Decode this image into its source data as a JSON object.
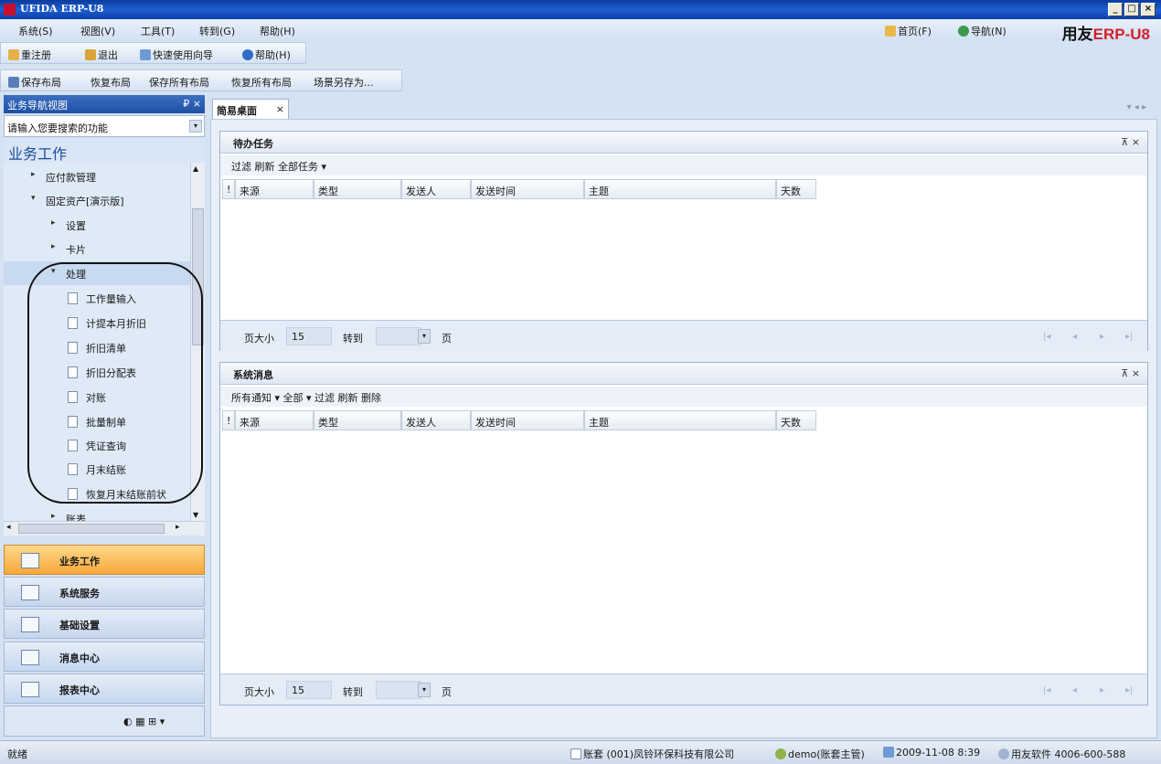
{
  "window": {
    "title": "UFIDA ERP-U8",
    "controls": [
      "_",
      "□",
      "×"
    ]
  },
  "menu": {
    "items": [
      "系统(S)",
      "视图(V)",
      "工具(T)",
      "转到(G)",
      "帮助(H)"
    ],
    "right": {
      "home": "首页(F)",
      "nav": "导航(N)"
    },
    "brand_a": "用友",
    "brand_b": "ERP",
    "brand_c": "-U8"
  },
  "toolbar1": {
    "relogin": "重注册",
    "exit": "退出",
    "guide": "快速使用向导",
    "help": "帮助(H)"
  },
  "toolbar2": {
    "save_layout": "保存布局",
    "restore_layout": "恢复布局",
    "save_all": "保存所有布局",
    "restore_all": "恢复所有布局",
    "scene_save": "场景另存为..."
  },
  "nav": {
    "header": "业务导航视图",
    "pin": "₽ ×",
    "search_placeholder": "请输入您要搜索的功能",
    "section": "业务工作",
    "tree": [
      {
        "label": "应付款管理"
      },
      {
        "label": "固定资产[演示版]"
      },
      {
        "label": "设置"
      },
      {
        "label": "卡片"
      },
      {
        "label": "处理"
      },
      {
        "label": "工作量输入"
      },
      {
        "label": "计提本月折旧"
      },
      {
        "label": "折旧清单"
      },
      {
        "label": "折旧分配表"
      },
      {
        "label": "对账"
      },
      {
        "label": "批量制单"
      },
      {
        "label": "凭证查询"
      },
      {
        "label": "月末结账"
      },
      {
        "label": "恢复月末结账前状"
      },
      {
        "label": "账表"
      }
    ],
    "big_buttons": [
      "业务工作",
      "系统服务",
      "基础设置",
      "消息中心",
      "报表中心"
    ]
  },
  "tab": {
    "label": "简易桌面",
    "close": "×",
    "arrows": "▾ ◂ ▸"
  },
  "todo": {
    "title": "待办任务",
    "controls": "⊼ ×",
    "toolbar": "过滤  刷新  全部任务 ▾",
    "columns": [
      "!",
      "来源",
      "类型",
      "发送人",
      "发送时间",
      "主题",
      "天数"
    ],
    "page_size_label": "页大小",
    "page_size": "15",
    "goto": "转到",
    "page_unit": "页",
    "dd": "▾",
    "nav_arrows": [
      "|◂",
      "◂",
      "▸",
      "▸|"
    ]
  },
  "messages": {
    "title": "系统消息",
    "controls": "⊼ ×",
    "toolbar": "所有通知 ▾  全部 ▾  过滤  刷新  删除",
    "columns": [
      "!",
      "来源",
      "类型",
      "发送人",
      "发送时间",
      "主题",
      "天数"
    ],
    "page_size_label": "页大小",
    "page_size": "15",
    "goto": "转到",
    "page_unit": "页",
    "dd": "▾",
    "nav_arrows": [
      "|◂",
      "◂",
      "▸",
      "▸|"
    ]
  },
  "status": {
    "ready": "就绪",
    "account": "账套 (001)凤铃环保科技有限公司",
    "user": "demo(账套主管)",
    "datetime": "2009-11-08 8:39",
    "vendor": "用友软件 4006-600-588"
  }
}
